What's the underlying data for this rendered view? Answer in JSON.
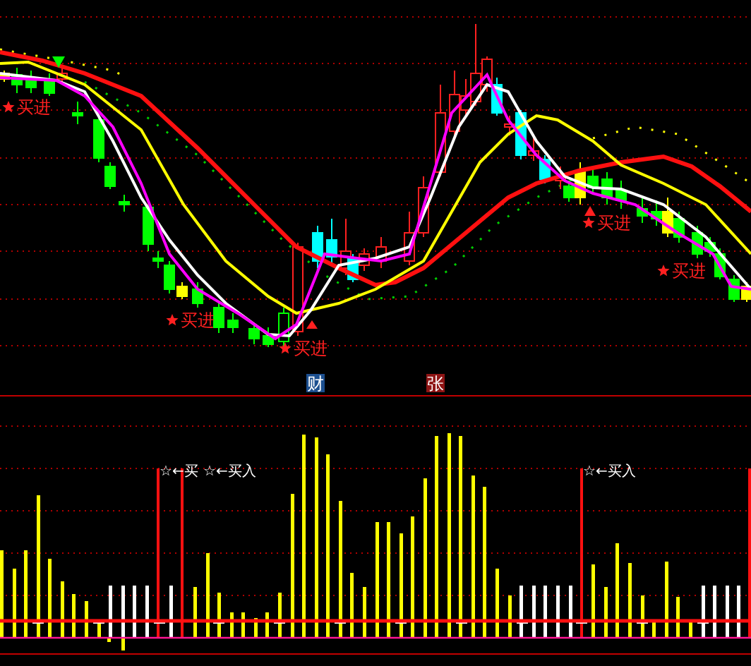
{
  "price_chart": {
    "signals": [
      {
        "label": "买进"
      },
      {
        "label": "买进"
      },
      {
        "label": "买进"
      },
      {
        "label": "买进"
      },
      {
        "label": "买进"
      }
    ]
  },
  "badges": [
    {
      "label": "财",
      "color": "#1c4f8f"
    },
    {
      "label": "张",
      "color": "#8e1414"
    }
  ],
  "volume_chart": {
    "signals": [
      {
        "label": "☆←买"
      },
      {
        "label": "☆←买入"
      },
      {
        "label": "☆←买入"
      }
    ]
  }
}
